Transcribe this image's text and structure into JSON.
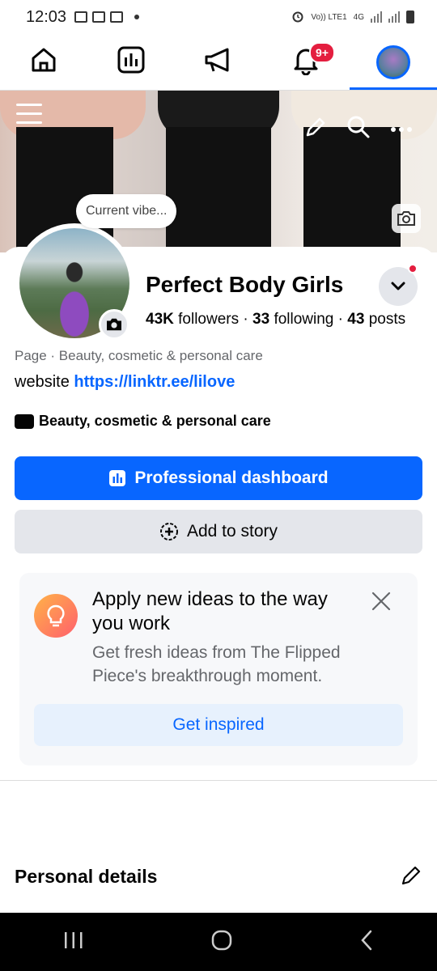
{
  "status_bar": {
    "time": "12:03",
    "network": "Vo)) LTE1",
    "network_type": "4G"
  },
  "colors": {
    "accent": "#0866ff",
    "badge": "#e41e3f",
    "text_secondary": "#65676b"
  },
  "nav": {
    "tabs": [
      {
        "icon": "home-icon"
      },
      {
        "icon": "dashboard-icon"
      },
      {
        "icon": "megaphone-icon"
      },
      {
        "icon": "bell-icon",
        "badge": "9+"
      },
      {
        "icon": "profile-avatar"
      }
    ]
  },
  "profile": {
    "note_bubble": "Current vibe...",
    "name": "Perfect Body Girls",
    "followers_count": "43K",
    "followers_label": "followers",
    "following_count": "33",
    "following_label": "following",
    "posts_count": "43",
    "posts_label": "posts",
    "category_line": "Page · Beauty, cosmetic & personal care",
    "website_label": "website",
    "website_url": "https://linktr.ee/lilove",
    "category_badge": "Beauty, cosmetic & personal care"
  },
  "buttons": {
    "professional_dashboard": "Professional dashboard",
    "add_to_story": "Add to story"
  },
  "card": {
    "title": "Apply new ideas to the way you work",
    "body": "Get fresh ideas from The Flipped Piece's breakthrough moment.",
    "button": "Get inspired"
  },
  "sections": {
    "personal_details": "Personal details"
  }
}
